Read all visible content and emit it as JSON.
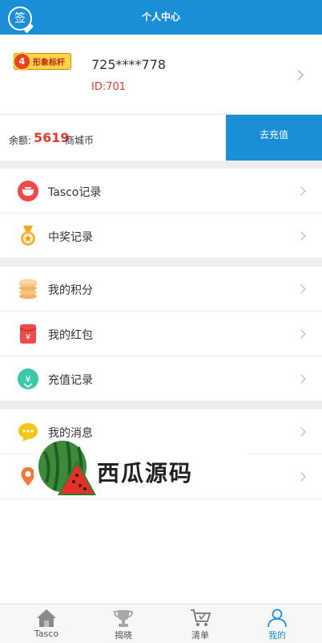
{
  "header": {
    "title": "个人中心",
    "sign_label": "签"
  },
  "profile": {
    "badge_level": "4",
    "badge_text": "形象标杆",
    "username": "725****778",
    "user_id": "ID:701"
  },
  "balance": {
    "label": "余额:",
    "value": "5619",
    "unit": "商城币",
    "recharge_label": "去充值"
  },
  "menu": [
    {
      "label": "Tasco记录",
      "icon": "pot-icon"
    },
    {
      "label": "中奖记录",
      "icon": "medal-icon"
    },
    {
      "label": "我的积分",
      "icon": "coins-icon"
    },
    {
      "label": "我的红包",
      "icon": "red-envelope-icon"
    },
    {
      "label": "充值记录",
      "icon": "recharge-icon"
    },
    {
      "label": "我的消息",
      "icon": "message-icon"
    },
    {
      "label": "",
      "icon": "location-icon"
    }
  ],
  "watermark": {
    "text": "西瓜源码"
  },
  "tabbar": [
    {
      "label": "Tasco",
      "icon": "home-icon"
    },
    {
      "label": "揭晓",
      "icon": "trophy-icon"
    },
    {
      "label": "清单",
      "icon": "cart-icon"
    },
    {
      "label": "我的",
      "icon": "user-icon"
    }
  ],
  "colors": {
    "primary": "#1a8fd8",
    "accent_red": "#e53a2e",
    "divider": "#eeeeee"
  }
}
